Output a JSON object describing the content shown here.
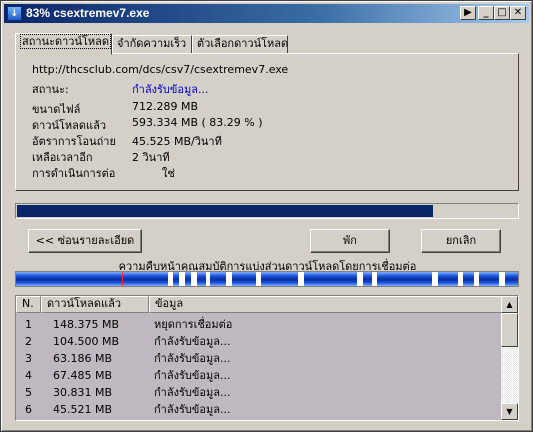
{
  "window": {
    "title": "83% csextremev7.exe",
    "icon_glyph": "↓",
    "buttons": {
      "play_glyph": "▶",
      "minimize_glyph": "_",
      "maximize_glyph": "□",
      "close_glyph": "✕"
    }
  },
  "tabs": [
    {
      "label": "สถานะดาวน์โหลด",
      "active": true
    },
    {
      "label": "จำกัดความเร็ว",
      "active": false
    },
    {
      "label": "ตัวเลือกดาวน์โหลด",
      "active": false
    }
  ],
  "status": {
    "url": "http://thcsclub.com/dcs/csv7/csextremev7.exe",
    "status_label": "สถานะ:",
    "status_value": "กำลังรับข้อมูล...",
    "file_size_label": "ขนาดไฟล์",
    "file_size_value": "712.289  MB",
    "downloaded_label": "ดาวน์โหลดแล้ว",
    "downloaded_value": "593.334  MB  ( 83.29 % )",
    "transfer_rate_label": "อัตราการโอนถ่าย",
    "transfer_rate_value": "45.525  MB/วินาที",
    "time_left_label": "เหลือเวลาอีก",
    "time_left_value": "2 วินาที",
    "resume_label": "การดำเนินการต่อ",
    "resume_value": "ใช่"
  },
  "progress": {
    "percent": 83.29
  },
  "buttons": {
    "hide_details": "<< ซ่อนรายละเอียด",
    "pause": "พัก",
    "cancel": "ยกเลิก"
  },
  "segments": {
    "label": "ความคืบหน้าคุณสมบัติการแบ่งส่วนดาวน์โหลดโดยการเชื่อมต่อ",
    "colors": {
      "segment": "#1a4fd8",
      "gap": "#ffffff",
      "marker": "#ff3030"
    }
  },
  "connections": {
    "columns": [
      "N.",
      "ดาวน์โหลดแล้ว",
      "ข้อมูล"
    ],
    "rows": [
      {
        "n": "1",
        "downloaded": "148.375  MB",
        "info": "หยุดการเชื่อมต่อ"
      },
      {
        "n": "2",
        "downloaded": "104.500  MB",
        "info": "กำลังรับข้อมูล..."
      },
      {
        "n": "3",
        "downloaded": "63.186  MB",
        "info": "กำลังรับข้อมูล..."
      },
      {
        "n": "4",
        "downloaded": "67.485  MB",
        "info": "กำลังรับข้อมูล..."
      },
      {
        "n": "5",
        "downloaded": "30.831  MB",
        "info": "กำลังรับข้อมูล..."
      },
      {
        "n": "6",
        "downloaded": "45.521  MB",
        "info": "กำลังรับข้อมูล..."
      }
    ]
  },
  "colors": {
    "title_bar": "#0a246a",
    "window_bg": "#d4d0c8",
    "progress_fill": "#0a246a",
    "status_link": "#0000cc",
    "list_bg": "#c0b8c0"
  }
}
